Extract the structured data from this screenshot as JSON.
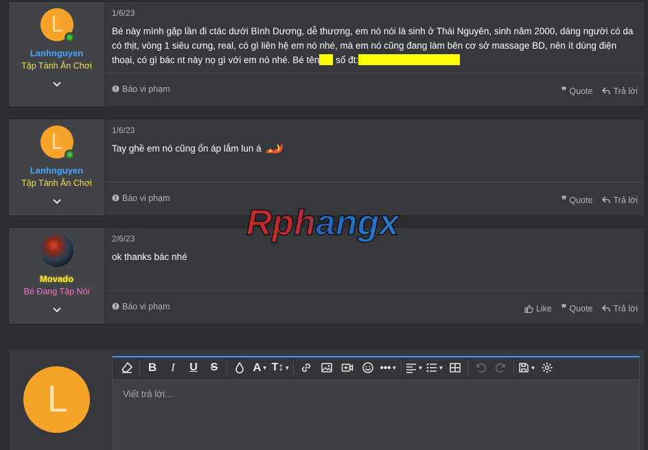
{
  "posts": [
    {
      "username": "Lanhnguyen",
      "user_title": "Tập Tành Ăn Chơi",
      "avatar_letter": "L",
      "date": "1/6/23",
      "body": "Bé này mình gặp lần đi ctác dưới Bình Dương, dễ thương, em nó nói là sinh ở Thái Nguyên, sinh năm 2000, dáng người có da có thịt, vòng 1 siêu cưng, real, có gì liên hệ em nó nhé, mà em nó cũng đang làm bên cơ sở massage BD, nên ít dùng điện thoại, có gì bác nt này nọ gì với em nó nhé. Bé tên",
      "body_mid": "số đt:",
      "report": "Báo vi phạm",
      "quote": "Quote",
      "reply": "Trả lời"
    },
    {
      "username": "Lanhnguyen",
      "user_title": "Tập Tành Ăn Chơi",
      "avatar_letter": "L",
      "date": "1/6/23",
      "body": "Tay ghề em nó cũng ổn áp lắm lun á",
      "report": "Báo vi phạm",
      "quote": "Quote",
      "reply": "Trả lời"
    },
    {
      "username": "Movado",
      "user_title": "Bé Đang Tập Nói",
      "date": "2/6/23",
      "body": "ok thanks bác nhé",
      "report": "Báo vi phạm",
      "like": "Like",
      "quote": "Quote",
      "reply": "Trả lời"
    }
  ],
  "watermark": "Rphangx",
  "reply_box": {
    "avatar_letter": "L",
    "placeholder": "Viết trả lời..."
  },
  "colors": {
    "background": "#2b2d31",
    "post_bg": "#36383c",
    "sidebar_bg": "#414347",
    "username_blue": "#4aa3ff",
    "title_yellow": "#f0e24a",
    "movado_name": "#ffee3a",
    "movado_title": "#f573c7",
    "avatar_orange": "#f6a32a",
    "redaction": "#ffff00",
    "editor_accent": "#3a9cf5"
  }
}
